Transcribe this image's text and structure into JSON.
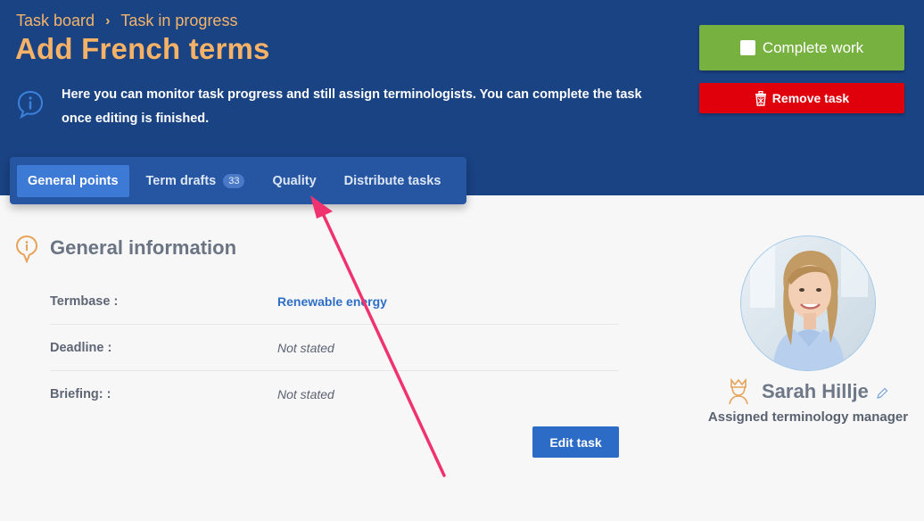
{
  "breadcrumb": {
    "items": [
      "Task board",
      "Task in progress"
    ],
    "separator": "›"
  },
  "header": {
    "title": "Add French terms",
    "info_text": "Here you can monitor task progress and still assign terminologists. You can complete the task once editing is finished.",
    "icon": "info-speech-bubble-icon"
  },
  "actions": {
    "complete_label": "Complete work",
    "remove_label": "Remove task",
    "complete_color": "#77b140",
    "remove_color": "#e0000b"
  },
  "tabs": [
    {
      "label": "General points",
      "active": true
    },
    {
      "label": "Term drafts",
      "badge": "33"
    },
    {
      "label": "Quality"
    },
    {
      "label": "Distribute tasks"
    }
  ],
  "general": {
    "title": "General information",
    "rows": [
      {
        "label": "Termbase :",
        "value": "Renewable energy"
      },
      {
        "label": "Deadline :",
        "value": "Not stated"
      },
      {
        "label": "Briefing: :",
        "value": "Not stated"
      }
    ],
    "edit_label": "Edit task"
  },
  "manager": {
    "name": "Sarah Hillje",
    "role": "Assigned terminology manager"
  },
  "colors": {
    "header_bg": "#1a4384",
    "accent_orange": "#f6b266",
    "link_blue": "#2e6ec7",
    "annotation_arrow": "#f0326f"
  }
}
